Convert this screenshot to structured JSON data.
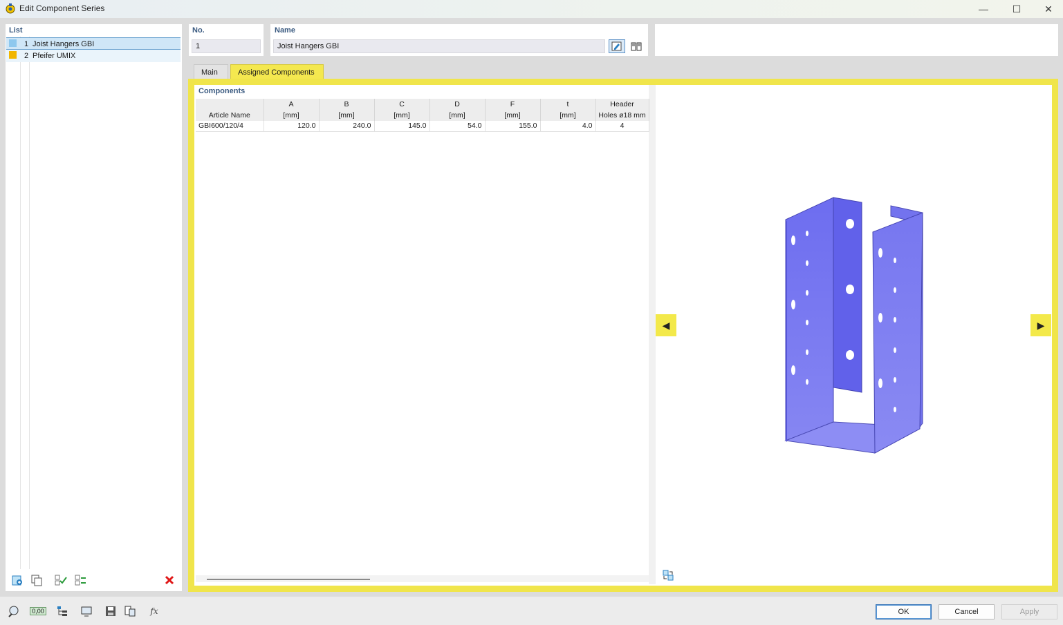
{
  "window": {
    "title": "Edit Component Series",
    "minimize_glyph": "—",
    "maximize_glyph": "☐",
    "close_glyph": "✕"
  },
  "list": {
    "label": "List",
    "items": [
      {
        "no": "1",
        "name": "Joist Hangers GBI",
        "color": "#8ec8ee",
        "selected": true
      },
      {
        "no": "2",
        "name": "Pfeifer UMIX",
        "color": "#f2b600",
        "selected": false
      }
    ],
    "toolbar_icons": [
      "new-item-icon",
      "copy-icon",
      "check-all-icon",
      "check-toggle-icon",
      "delete-icon"
    ]
  },
  "header": {
    "no_label": "No.",
    "no_value": "1",
    "name_label": "Name",
    "name_value": "Joist Hangers GBI"
  },
  "tabs": [
    {
      "label": "Main",
      "active": false
    },
    {
      "label": "Assigned Components",
      "active": true
    }
  ],
  "components": {
    "label": "Components",
    "columns": [
      {
        "top": "",
        "bottom": "Article Name"
      },
      {
        "top": "A",
        "bottom": "[mm]"
      },
      {
        "top": "B",
        "bottom": "[mm]"
      },
      {
        "top": "C",
        "bottom": "[mm]"
      },
      {
        "top": "D",
        "bottom": "[mm]"
      },
      {
        "top": "F",
        "bottom": "[mm]"
      },
      {
        "top": "t",
        "bottom": "[mm]"
      },
      {
        "top": "Header",
        "bottom": "Holes ø18 mm"
      }
    ],
    "rows": [
      [
        "GBI600/120/4",
        "120.0",
        "240.0",
        "145.0",
        "54.0",
        "155.0",
        "4.0",
        "4"
      ]
    ]
  },
  "preview": {
    "part_color": "#7b7bf0",
    "prev_glyph": "◀",
    "next_glyph": "▶"
  },
  "footer": {
    "ok": "OK",
    "cancel": "Cancel",
    "apply": "Apply",
    "bottom_icons": [
      "search-icon",
      "units-icon",
      "tree-icon",
      "view-icon",
      "save-icon",
      "library-icon",
      "formula-icon"
    ],
    "units_text": "0,00",
    "formula_text": "fx"
  }
}
